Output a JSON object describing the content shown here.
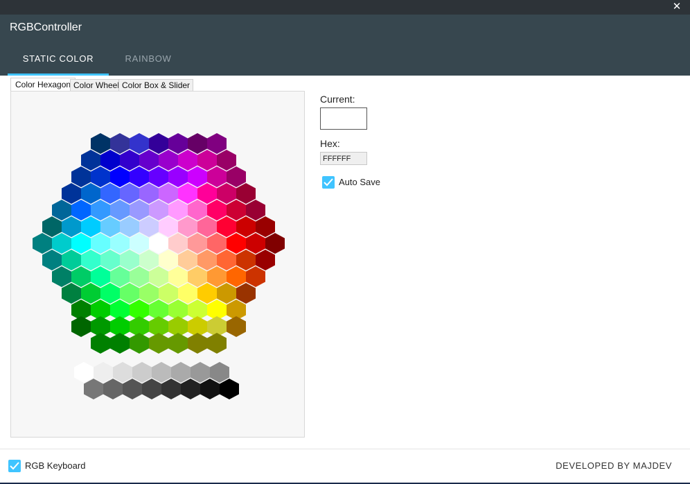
{
  "window": {
    "close_symbol": "✕"
  },
  "app": {
    "title": "RGBController"
  },
  "tabs": [
    {
      "label": "STATIC COLOR",
      "active": true
    },
    {
      "label": "RAINBOW",
      "active": false
    }
  ],
  "subtabs": [
    {
      "label": "Color Hexagon",
      "active": true
    },
    {
      "label": "Color Wheel",
      "active": false
    },
    {
      "label": "Color Box & Slider",
      "active": false
    }
  ],
  "current": {
    "label": "Current:",
    "color": "#FFFFFF"
  },
  "hex": {
    "label": "Hex:",
    "value": "FFFFFF"
  },
  "auto_save": {
    "label": "Auto Save",
    "checked": true
  },
  "footer": {
    "keyboard_label": "RGB Keyboard",
    "keyboard_checked": true,
    "developer": "DEVELOPED BY MAJDEV"
  },
  "theme": {
    "accent": "#40c4ff",
    "header": "#37474f",
    "titlebar": "#2d3338"
  },
  "palette": {
    "rows": [
      [
        "#003366",
        "#333399",
        "#3333cc",
        "#330099",
        "#660099",
        "#660066",
        "#800080"
      ],
      [
        "#003399",
        "#0000cc",
        "#3300cc",
        "#6600cc",
        "#9900cc",
        "#cc00cc",
        "#cc0099",
        "#990066"
      ],
      [
        "#003399",
        "#0033cc",
        "#0000ff",
        "#3300ff",
        "#6600ff",
        "#9900ff",
        "#cc00ff",
        "#cc0099",
        "#990066"
      ],
      [
        "#003399",
        "#0066cc",
        "#3366ff",
        "#6666ff",
        "#9966ff",
        "#cc66ff",
        "#ff33ff",
        "#ff0099",
        "#cc0066",
        "#990033"
      ],
      [
        "#006699",
        "#0066ff",
        "#3399ff",
        "#6699ff",
        "#9999ff",
        "#cc99ff",
        "#ff99ff",
        "#ff66cc",
        "#ff0066",
        "#cc0033",
        "#990033"
      ],
      [
        "#006666",
        "#0099cc",
        "#00ccff",
        "#66ccff",
        "#99ccff",
        "#ccccff",
        "#ffccff",
        "#ff99cc",
        "#ff6699",
        "#ff0033",
        "#cc0000",
        "#990000"
      ],
      [
        "#008080",
        "#00cccc",
        "#00ffff",
        "#66ffff",
        "#99ffff",
        "#ccffff",
        "#ffffff",
        "#ffcccc",
        "#ff9999",
        "#ff6666",
        "#ff0000",
        "#cc0000",
        "#800000"
      ],
      [
        "#008080",
        "#00cc99",
        "#33ffcc",
        "#66ffcc",
        "#99ffcc",
        "#ccffcc",
        "#ffffcc",
        "#ffcc99",
        "#ff9966",
        "#ff6633",
        "#cc3300",
        "#990000"
      ],
      [
        "#008066",
        "#00cc66",
        "#00ff99",
        "#66ff99",
        "#99ff99",
        "#ccff99",
        "#ffff99",
        "#ffcc66",
        "#ff9933",
        "#ff6600",
        "#cc3300"
      ],
      [
        "#008040",
        "#00cc33",
        "#00ff66",
        "#66ff66",
        "#99ff66",
        "#ccff66",
        "#ffff66",
        "#ffcc00",
        "#cc9900",
        "#993300"
      ],
      [
        "#008000",
        "#00cc00",
        "#00ff33",
        "#33ff00",
        "#66ff33",
        "#99ff33",
        "#ccff33",
        "#ffff00",
        "#cc9900"
      ],
      [
        "#006600",
        "#009900",
        "#00cc00",
        "#33cc00",
        "#66cc00",
        "#99cc00",
        "#cccc00",
        "#cccc33",
        "#996600"
      ],
      [
        "#008000",
        "#008000",
        "#339900",
        "#669900",
        "#669900",
        "#808000",
        "#808000"
      ]
    ],
    "grays_top": [
      "#ffffff",
      "#eeeeee",
      "#dddddd",
      "#cccccc",
      "#bbbbbb",
      "#aaaaaa",
      "#999999",
      "#888888"
    ],
    "grays_bottom": [
      "#777777",
      "#666666",
      "#555555",
      "#444444",
      "#333333",
      "#222222",
      "#111111",
      "#000000"
    ]
  }
}
